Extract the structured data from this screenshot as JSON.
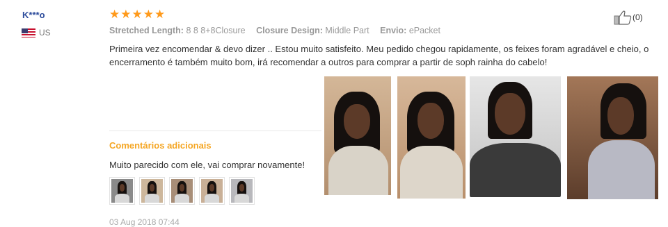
{
  "reviewer": {
    "name": "K***o",
    "country": "US"
  },
  "rating": {
    "stars": 5,
    "max": 5
  },
  "helpful": {
    "count": "(0)",
    "icon": "thumbs-up-icon"
  },
  "attributes": [
    {
      "key": "Stretched Length:",
      "value": "8 8 8+8Closure"
    },
    {
      "key": "Closure Design:",
      "value": "Middle Part"
    },
    {
      "key": "Envio:",
      "value": "ePacket"
    }
  ],
  "review_text": "Primeira vez encomendar & devo dizer .. Estou muito satisfeito. Meu pedido chegou rapidamente, os feixes foram agradável e cheio, o encerramento é também muito bom, irá recomendar a outros para comprar a partir de soph rainha do cabelo!",
  "additional": {
    "title": "Comentários adicionais",
    "text": "Muito parecido com ele, vai comprar novamente!"
  },
  "date": "03 Aug 2018 07:44",
  "colors": {
    "star": "#ff9a1b",
    "accent": "#f5a623",
    "name": "#2e4d9c"
  }
}
